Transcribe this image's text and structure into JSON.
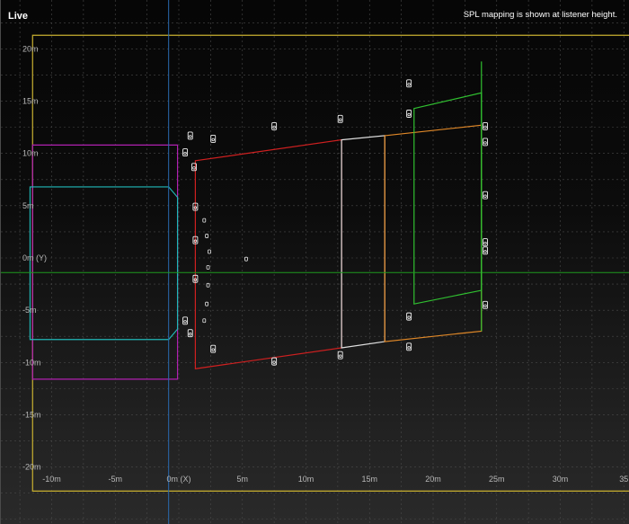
{
  "view": {
    "title": "Live",
    "notice": "SPL mapping is shown at listener height."
  },
  "axes": {
    "x_ticks": [
      {
        "value": -10,
        "label": "-10m"
      },
      {
        "value": -5,
        "label": "-5m"
      },
      {
        "value": 0,
        "label": "0m (X)"
      },
      {
        "value": 5,
        "label": "5m"
      },
      {
        "value": 10,
        "label": "10m"
      },
      {
        "value": 15,
        "label": "15m"
      },
      {
        "value": 20,
        "label": "20m"
      },
      {
        "value": 25,
        "label": "25m"
      },
      {
        "value": 30,
        "label": "30m"
      },
      {
        "value": 35,
        "label": "35"
      }
    ],
    "y_ticks": [
      {
        "value": 20,
        "label": "20m"
      },
      {
        "value": 15,
        "label": "15m"
      },
      {
        "value": 10,
        "label": "10m"
      },
      {
        "value": 5,
        "label": "5m"
      },
      {
        "value": 0,
        "label": "0m (Y)"
      },
      {
        "value": -5,
        "label": "-5m"
      },
      {
        "value": -10,
        "label": "-10m"
      },
      {
        "value": -15,
        "label": "-15m"
      },
      {
        "value": -20,
        "label": "-20m"
      }
    ]
  },
  "zones": [
    {
      "name": "outer-bounds",
      "color": "#c8b030",
      "points": [
        [
          -11.5,
          21.3
        ],
        [
          35.5,
          21.3
        ],
        [
          35.5,
          -22.3
        ],
        [
          -11.5,
          -22.3
        ]
      ]
    },
    {
      "name": "stage-magenta",
      "color": "#b020b0",
      "points": [
        [
          -11.5,
          10.8
        ],
        [
          -0.1,
          10.8
        ],
        [
          -0.1,
          -11.6
        ],
        [
          -11.5,
          -11.6
        ]
      ]
    },
    {
      "name": "stage-cyan",
      "color": "#20b8b8",
      "points": [
        [
          -11.7,
          6.8
        ],
        [
          -0.8,
          6.8
        ],
        [
          -0.1,
          5.8
        ],
        [
          -0.1,
          -6.8
        ],
        [
          -0.8,
          -7.8
        ],
        [
          -11.7,
          -7.8
        ]
      ]
    },
    {
      "name": "audience-red",
      "color": "#d02020",
      "points": [
        [
          1.3,
          9.3
        ],
        [
          12.8,
          11.3
        ],
        [
          12.8,
          -8.6
        ],
        [
          1.3,
          -10.6
        ]
      ]
    },
    {
      "name": "audience-white",
      "color": "#e0e0e0",
      "points": [
        [
          12.8,
          11.3
        ],
        [
          16.2,
          11.7
        ],
        [
          16.2,
          -8.0
        ],
        [
          12.8,
          -8.6
        ]
      ]
    },
    {
      "name": "audience-orange",
      "color": "#e08828",
      "points": [
        [
          16.2,
          11.7
        ],
        [
          23.8,
          12.7
        ],
        [
          23.8,
          -7.0
        ],
        [
          16.2,
          -8.0
        ]
      ]
    },
    {
      "name": "balcony-green",
      "color": "#30c030",
      "points": [
        [
          18.5,
          14.3
        ],
        [
          23.8,
          15.8
        ],
        [
          23.8,
          -3.1
        ],
        [
          18.5,
          -4.4
        ]
      ]
    }
  ],
  "green_vertical_x": 23.8,
  "green_vertical_range": [
    -7.0,
    18.8
  ],
  "speakers": [
    [
      0.9,
      11.7
    ],
    [
      0.5,
      10.1
    ],
    [
      1.2,
      8.7
    ],
    [
      1.3,
      4.9
    ],
    [
      1.3,
      1.7
    ],
    [
      1.3,
      -2.0
    ],
    [
      0.5,
      -6.0
    ],
    [
      0.9,
      -7.2
    ],
    [
      2.7,
      11.4
    ],
    [
      2.7,
      -8.7
    ],
    [
      7.5,
      12.6
    ],
    [
      7.5,
      -9.9
    ],
    [
      12.7,
      13.3
    ],
    [
      12.7,
      -9.3
    ],
    [
      18.1,
      16.7
    ],
    [
      18.1,
      13.8
    ],
    [
      18.1,
      -5.6
    ],
    [
      18.1,
      -8.5
    ],
    [
      24.1,
      12.6
    ],
    [
      24.1,
      11.1
    ],
    [
      24.1,
      6.0
    ],
    [
      24.1,
      1.5
    ],
    [
      24.1,
      0.7
    ],
    [
      24.1,
      -4.5
    ]
  ],
  "small_points": [
    [
      2.0,
      3.6
    ],
    [
      2.2,
      2.1
    ],
    [
      2.4,
      0.6
    ],
    [
      2.3,
      -0.9
    ],
    [
      2.3,
      -2.6
    ],
    [
      2.2,
      -4.4
    ],
    [
      2.0,
      -6.0
    ],
    [
      5.3,
      -0.1
    ]
  ]
}
